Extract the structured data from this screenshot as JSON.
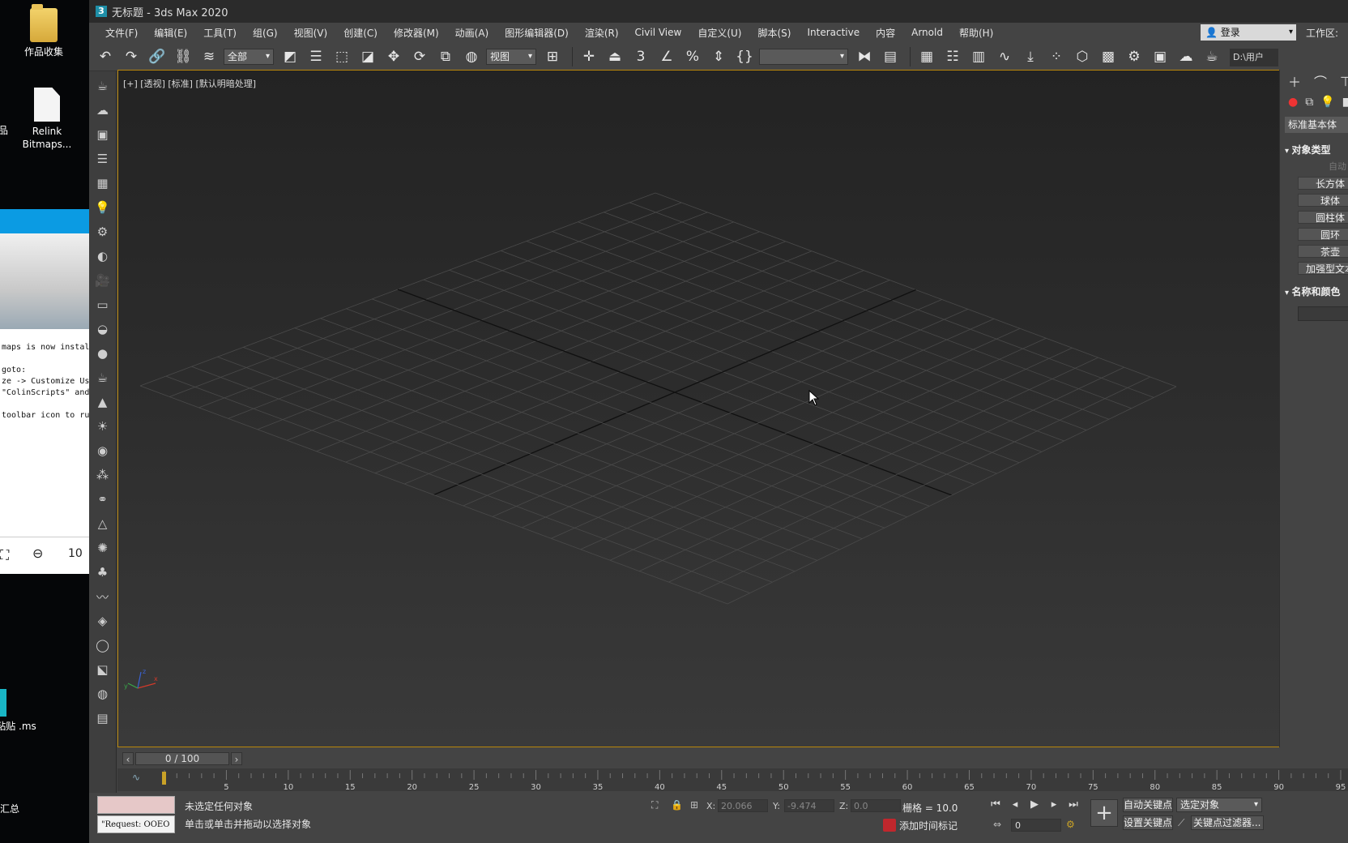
{
  "desktop": {
    "icons": [
      {
        "label": "作品收集"
      },
      {
        "label": "Relink Bitmaps..."
      },
      {
        "label": "粘贴 .ms"
      },
      {
        "label": "汇总"
      }
    ],
    "side_fragment": "作品",
    "code_lines": [
      "maps is now instal",
      "",
      "goto:",
      "ze -> Customize Us",
      "\"ColinScripts\" and",
      "",
      "toolbar icon to ru"
    ],
    "zoom_text": "10"
  },
  "app": {
    "title": "无标题 - 3ds Max 2020",
    "icon_letter": "3"
  },
  "menu": {
    "items": [
      "文件(F)",
      "编辑(E)",
      "工具(T)",
      "组(G)",
      "视图(V)",
      "创建(C)",
      "修改器(M)",
      "动画(A)",
      "图形编辑器(D)",
      "渲染(R)",
      "Civil View",
      "自定义(U)",
      "脚本(S)",
      "Interactive",
      "内容",
      "Arnold",
      "帮助(H)"
    ],
    "login": "登录",
    "workspace": "工作区:"
  },
  "toolbar": {
    "selection_filter": "全部",
    "ref_coord": "视图",
    "named_selection": "",
    "path": "D:\\用户"
  },
  "viewport": {
    "label": "[+] [透视] [标准] [默认明暗处理]",
    "axis_labels": {
      "x": "x",
      "y": "y",
      "z": "z"
    }
  },
  "command_panel": {
    "category": "标准基本体",
    "rollout_object_type": "对象类型",
    "auto_grid": "自动",
    "primitives": [
      "长方体",
      "球体",
      "圆柱体",
      "圆环",
      "茶壶",
      "加强型文本"
    ],
    "rollout_name_color": "名称和颜色"
  },
  "timeline": {
    "frame_display": "0 / 100",
    "ticks": [
      5,
      10,
      15,
      20,
      25,
      30,
      35,
      40,
      45,
      50,
      55,
      60,
      65,
      70,
      75,
      80,
      85,
      90,
      95
    ]
  },
  "status": {
    "request_text": "\"Request: OOEO",
    "line1": "未选定任何对象",
    "line2": "单击或单击并拖动以选择对象",
    "x_label": "X:",
    "x_value": "20.066",
    "y_label": "Y:",
    "y_value": "-9.474",
    "z_label": "Z:",
    "z_value": "0.0",
    "grid": "栅格 = 10.0",
    "add_time_tag": "添加时间标记",
    "frame_value": "0",
    "auto_key": "自动关键点",
    "set_key": "设置关键点",
    "selected_object": "选定对象",
    "key_filters": "关键点过滤器..."
  },
  "colors": {
    "viewport_border": "#b8860b",
    "accent_blue": "#0b9be3",
    "record_red": "#c0272d"
  }
}
